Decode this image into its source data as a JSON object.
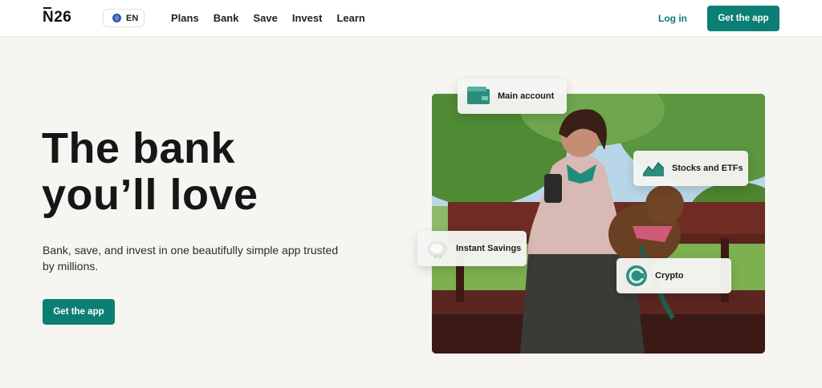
{
  "header": {
    "logo": "N26",
    "language": "EN",
    "nav": [
      "Plans",
      "Bank",
      "Save",
      "Invest",
      "Learn"
    ],
    "login": "Log in",
    "cta": "Get the app"
  },
  "hero": {
    "title_line1": "The bank",
    "title_line2": "you’ll love",
    "subtitle": "Bank, save, and invest in one beautifully simple app trusted by millions.",
    "cta": "Get the app"
  },
  "cards": {
    "main_account": "Main account",
    "stocks": "Stocks and ETFs",
    "savings": "Instant Savings",
    "crypto": "Crypto"
  },
  "colors": {
    "brand": "#0b7f73",
    "link": "#0e7b71",
    "background": "#f7f5f2"
  }
}
